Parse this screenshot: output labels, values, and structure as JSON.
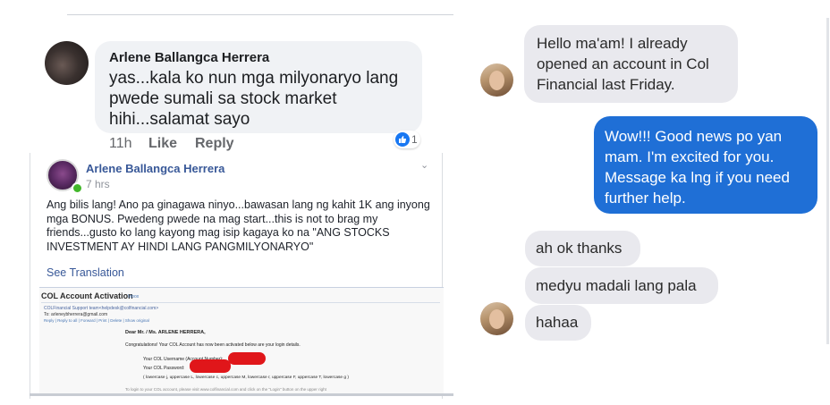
{
  "comment": {
    "author": "Arlene Ballangca Herrera",
    "text": "yas...kala ko nun mga milyonaryo lang pwede sumali sa stock market hihi...salamat sayo",
    "time": "11h",
    "like_label": "Like",
    "reply_label": "Reply",
    "reaction_count": "1"
  },
  "post": {
    "author": "Arlene Ballangca Herrera",
    "time": "7 hrs",
    "text": "Ang bilis lang! Ano pa ginagawa ninyo...bawasan lang ng kahit 1K ang inyong mga BONUS. Pwedeng pwede na mag start...this is not to brag my friends...gusto ko lang kayong mag isip kagaya ko na \"ANG STOCKS INVESTMENT AY HINDI LANG PANGMILYONARYO\"",
    "see_translation": "See Translation",
    "email": {
      "title": "COL Account Activation",
      "title_link": "Inbox",
      "from": "COLFinancial Support team<helpdesk@colfinancial.com>",
      "to": "To: arleneybherrera@gmail.com",
      "actions": "Reply | Reply to all | Forward | Print | Delete | Show original",
      "greeting": "Dear Mr. / Ms. ARLENE HERRERA,",
      "congrats": "Congratulations! Your COL Account has now been activated below are your login details.",
      "username_label": "Your COL Username (Account Number):",
      "password_label": "Your COL Password:",
      "case_hint": "( lowercase j, uppercase L, lowercase c, uppercase M, lowercase r, uppercase F, uppercase T, lowercase g )",
      "footer_faint": "To login to your COL account, please visit www.colfinancial.com and click on the \"Login\" button on the upper right"
    }
  },
  "messenger": {
    "messages": [
      {
        "from": "them",
        "text": "Hello ma'am! I already opened an account in Col Financial last Friday."
      },
      {
        "from": "me",
        "text": "Wow!!! Good news po yan mam. I'm excited for you. Message ka lng if you need further help."
      },
      {
        "from": "them",
        "text": "ah ok thanks"
      },
      {
        "from": "them",
        "text": "medyu madali lang pala"
      },
      {
        "from": "them",
        "text": "hahaa"
      }
    ],
    "colors": {
      "outgoing": "#1f6fd6",
      "incoming": "#e9e9ee"
    }
  }
}
